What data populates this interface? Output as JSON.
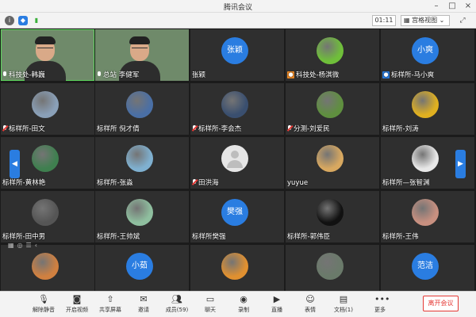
{
  "window": {
    "title": "腾讯会议"
  },
  "infobar": {
    "timer": "01:11",
    "view_label": "宫格视图"
  },
  "participants": [
    {
      "name": "科技处-韩巍",
      "mic": "on",
      "kind": "video"
    },
    {
      "name": "总站 李健军",
      "mic": "on",
      "kind": "video"
    },
    {
      "name": "张颖",
      "mic": "none",
      "kind": "text",
      "avatar_text": "张颖"
    },
    {
      "name": "科技处-杨淇微",
      "mic": "none",
      "kind": "photo",
      "role": "host",
      "avatar_color": "#6fbf3a"
    },
    {
      "name": "标样所-马小爽",
      "mic": "none",
      "kind": "text",
      "role": "cohost",
      "avatar_text": "小爽"
    },
    {
      "name": "标样所-田文",
      "mic": "muted",
      "kind": "photo",
      "avatar_color": "#8aa0b8"
    },
    {
      "name": "标样所 倪才倩",
      "mic": "none",
      "kind": "photo",
      "avatar_color": "#4a6fa5"
    },
    {
      "name": "标样所-李会杰",
      "mic": "muted",
      "kind": "photo",
      "avatar_color": "#3a4f6f"
    },
    {
      "name": "分测-刘爱民",
      "mic": "muted",
      "kind": "photo",
      "avatar_color": "#5f8f3f"
    },
    {
      "name": "标样所-刘涛",
      "mic": "none",
      "kind": "photo",
      "avatar_color": "#e0b020"
    },
    {
      "name": "标样所-黄林艳",
      "mic": "none",
      "kind": "photo",
      "avatar_color": "#3f7f4f"
    },
    {
      "name": "标样所-张淼",
      "mic": "none",
      "kind": "photo",
      "avatar_color": "#7fb0d0"
    },
    {
      "name": "田洪海",
      "mic": "muted",
      "kind": "default"
    },
    {
      "name": "yuyue",
      "mic": "none",
      "kind": "photo",
      "avatar_color": "#d8a860"
    },
    {
      "name": "标样所—张智渊",
      "mic": "none",
      "kind": "photo",
      "avatar_color": "#e8e8e8"
    },
    {
      "name": "标样所-田中男",
      "mic": "none",
      "kind": "photo",
      "avatar_color": "#555555"
    },
    {
      "name": "标样所-王帅斌",
      "mic": "none",
      "kind": "photo",
      "avatar_color": "#8fbf9f"
    },
    {
      "name": "标样所樊强",
      "mic": "none",
      "kind": "text",
      "avatar_text": "樊强"
    },
    {
      "name": "标样所-郭伟臣",
      "mic": "none",
      "kind": "photo",
      "avatar_color": "#111111"
    },
    {
      "name": "标样所-王伟",
      "mic": "none",
      "kind": "photo",
      "avatar_color": "#c89080"
    },
    {
      "name": "",
      "mic": "none",
      "kind": "photo",
      "avatar_color": "#d08040"
    },
    {
      "name": "",
      "mic": "none",
      "kind": "text",
      "avatar_text": "小茹"
    },
    {
      "name": "",
      "mic": "none",
      "kind": "photo",
      "avatar_color": "#e09030"
    },
    {
      "name": "",
      "mic": "none",
      "kind": "photo",
      "avatar_color": "#6a7a6a"
    },
    {
      "name": "",
      "mic": "none",
      "kind": "text",
      "avatar_text": "范洁"
    }
  ],
  "toolbar": {
    "unmute": "解除静音",
    "start_video": "开启视频",
    "share_screen": "共享屏幕",
    "invite": "邀请",
    "members": "成员(59)",
    "chat": "聊天",
    "record": "录制",
    "live": "直播",
    "reactions": "表情",
    "docs": "文档(1)",
    "more": "更多",
    "leave": "离开会议"
  }
}
